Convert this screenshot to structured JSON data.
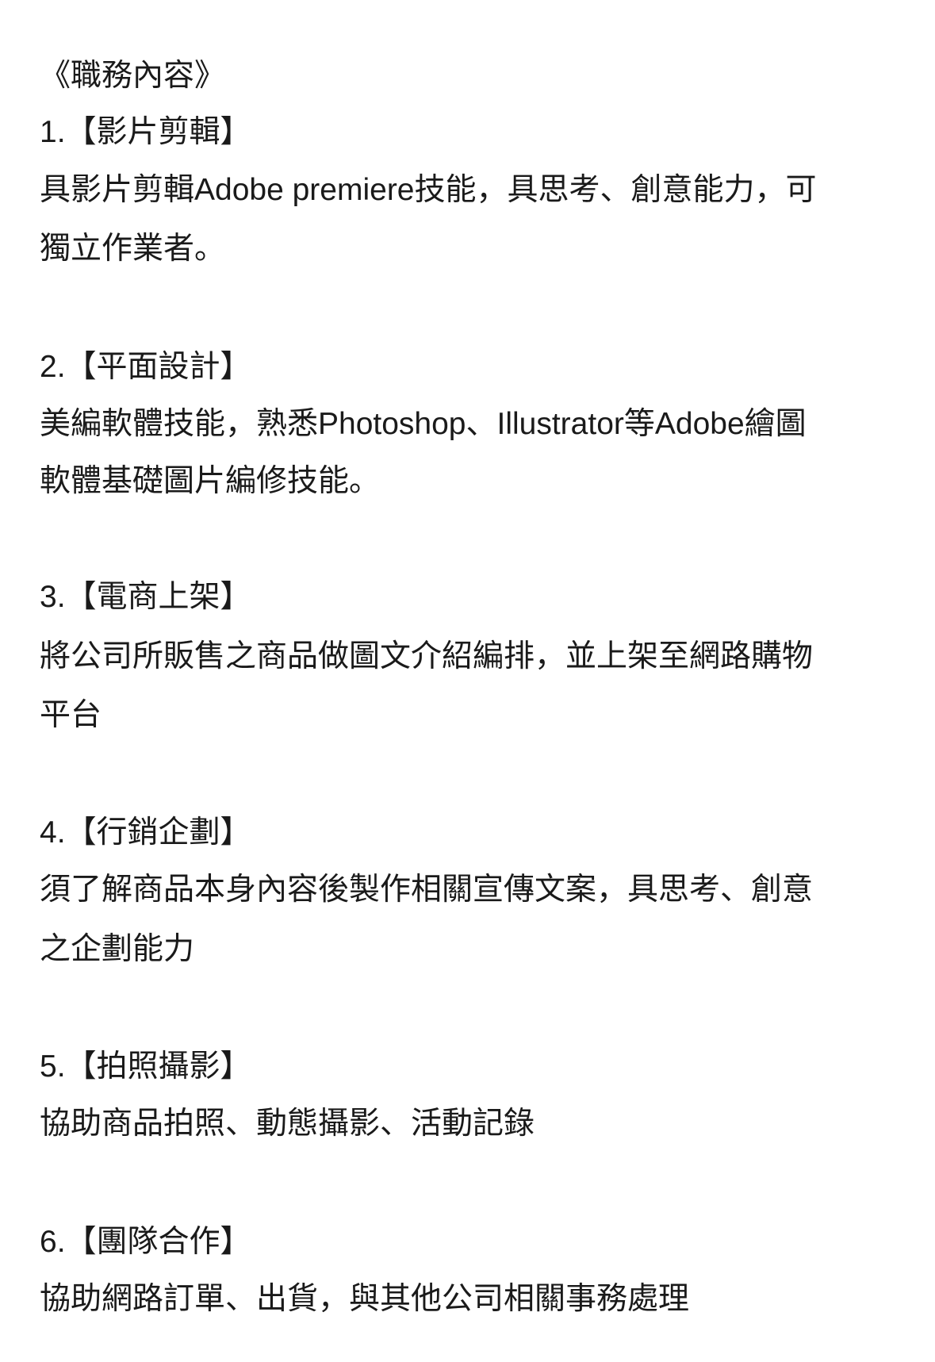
{
  "title": "《職務內容》",
  "sections": [
    {
      "heading": "1.【影片剪輯】",
      "lines": [
        "具影片剪輯Adobe premiere技能，具思考、創意能力，可",
        "獨立作業者。"
      ]
    },
    {
      "heading": "2.【平面設計】",
      "lines": [
        "美編軟體技能，熟悉Photoshop、Illustrator等Adobe繪圖",
        "軟體基礎圖片編修技能。"
      ]
    },
    {
      "heading": "3.【電商上架】",
      "lines": [
        "將公司所販售之商品做圖文介紹編排，並上架至網路購物",
        "平台"
      ]
    },
    {
      "heading": "4.【行銷企劃】",
      "lines": [
        "須了解商品本身內容後製作相關宣傳文案，具思考、創意",
        "之企劃能力"
      ]
    },
    {
      "heading": "5.【拍照攝影】",
      "lines": [
        "協助商品拍照、動態攝影、活動記錄"
      ]
    },
    {
      "heading": "6.【團隊合作】",
      "lines": [
        "協助網路訂單、出貨，與其他公司相關事務處理"
      ]
    }
  ]
}
